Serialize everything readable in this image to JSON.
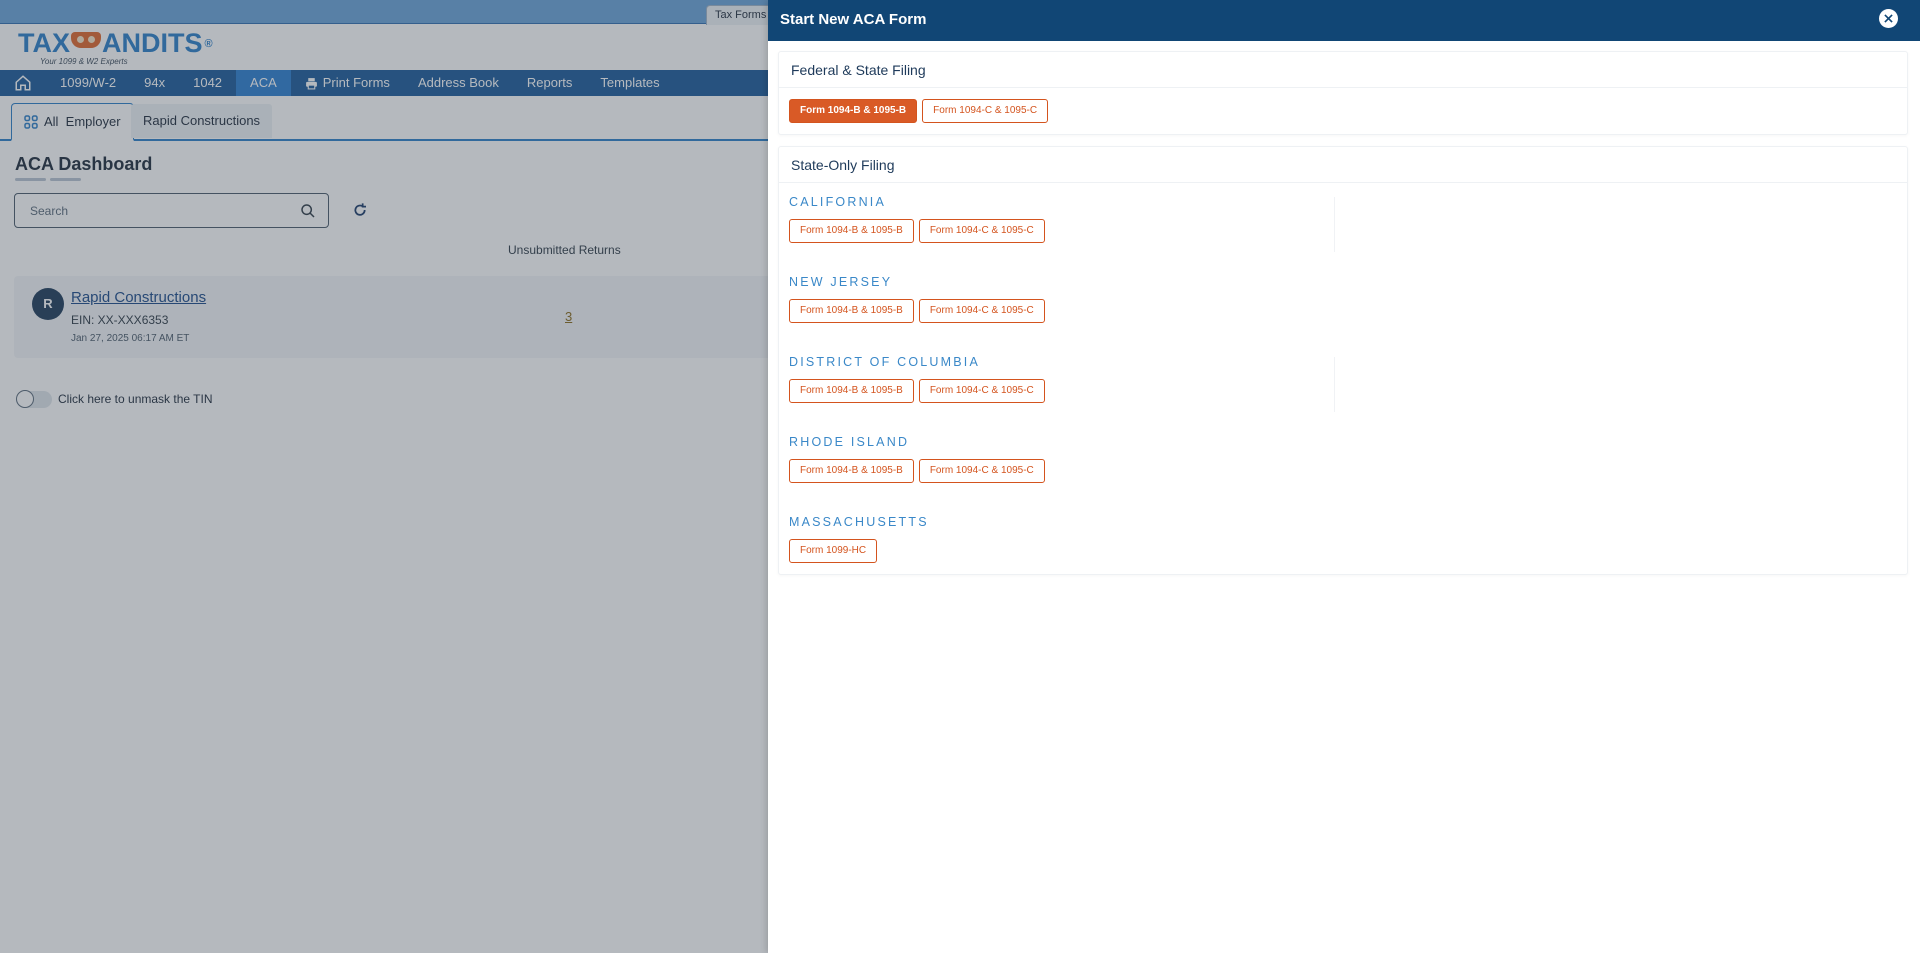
{
  "window": {
    "tax_forms_tab": "Tax Forms"
  },
  "logo": {
    "left_text": "TAX",
    "right_text": "ANDITS",
    "reg_mark": "®",
    "tagline": "Your 1099 & W2 Experts"
  },
  "nav": {
    "home_icon": "home-icon",
    "items": [
      {
        "label": "1099/W-2"
      },
      {
        "label": "94x"
      },
      {
        "label": "1042"
      },
      {
        "label": "ACA",
        "active": true
      },
      {
        "label": "Print Forms",
        "icon": "printer-icon"
      },
      {
        "label": "Address Book"
      },
      {
        "label": "Reports"
      },
      {
        "label": "Templates"
      }
    ]
  },
  "employer_tabs": [
    {
      "label": "All  Employer",
      "icon": "grid-icon",
      "active": true
    },
    {
      "label": "Rapid Constructions"
    }
  ],
  "dashboard": {
    "title": "ACA Dashboard",
    "search_placeholder": "Search",
    "column_header": "Unsubmitted Returns",
    "employers": [
      {
        "initial": "R",
        "name": "Rapid Constructions",
        "ein": "EIN: XX-XXX6353",
        "date": "Jan 27, 2025 06:17 AM ET",
        "unsubmitted": "3"
      }
    ],
    "unmask_toggle_label": "Click here to unmask the TIN",
    "unmask_toggle_on": false
  },
  "panel": {
    "title": "Start New ACA Form",
    "federal": {
      "heading": "Federal & State Filing",
      "buttons": [
        {
          "label": "Form 1094-B & 1095-B",
          "selected": true
        },
        {
          "label": "Form 1094-C & 1095-C",
          "selected": false
        }
      ]
    },
    "state_only": {
      "heading": "State-Only Filing",
      "states": [
        {
          "name": "CALIFORNIA",
          "buttons": [
            {
              "label": "Form 1094-B & 1095-B"
            },
            {
              "label": "Form 1094-C & 1095-C"
            }
          ]
        },
        {
          "name": "NEW JERSEY",
          "buttons": [
            {
              "label": "Form 1094-B & 1095-B"
            },
            {
              "label": "Form 1094-C & 1095-C"
            }
          ]
        },
        {
          "name": "DISTRICT OF COLUMBIA",
          "buttons": [
            {
              "label": "Form 1094-B & 1095-B"
            },
            {
              "label": "Form 1094-C & 1095-C"
            }
          ]
        },
        {
          "name": "RHODE ISLAND",
          "buttons": [
            {
              "label": "Form 1094-B & 1095-B"
            },
            {
              "label": "Form 1094-C & 1095-C"
            }
          ]
        },
        {
          "name": "MASSACHUSETTS",
          "buttons": [
            {
              "label": "Form 1099-HC"
            }
          ]
        }
      ]
    }
  },
  "colors": {
    "panel_header": "#114675",
    "nav_bar": "#1a5a9a",
    "nav_active": "#2a7ed0",
    "accent_orange": "#d95a26",
    "state_label_blue": "#3a88c8"
  }
}
